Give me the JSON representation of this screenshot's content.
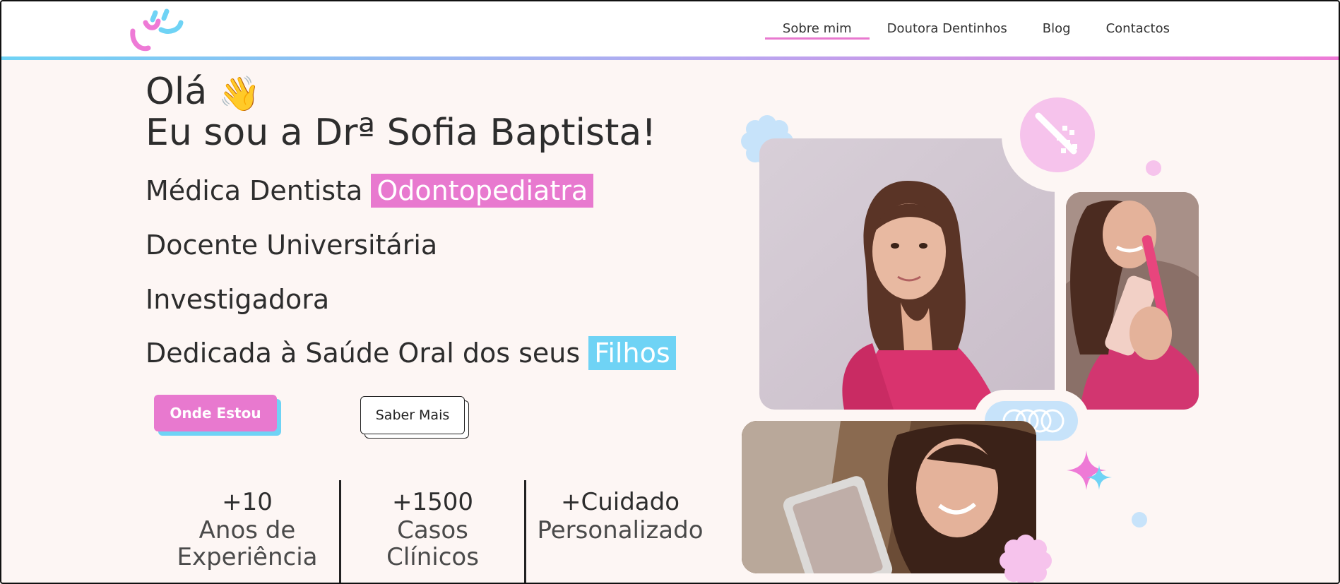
{
  "nav": {
    "items": [
      {
        "label": "Sobre mim",
        "active": true
      },
      {
        "label": "Doutora Dentinhos",
        "active": false
      },
      {
        "label": "Blog",
        "active": false
      },
      {
        "label": "Contactos",
        "active": false
      }
    ]
  },
  "hero": {
    "greeting": "Olá",
    "wave_emoji": "👋",
    "name": "Eu sou a Drª Sofia Baptista!",
    "roles": {
      "role1_prefix": "Médica Dentista",
      "role1_highlight": "Odontopediatra",
      "role2": "Docente Universitária",
      "role3": "Investigadora",
      "role4_prefix": "Dedicada à Saúde Oral dos seus",
      "role4_highlight": "Filhos"
    },
    "buttons": {
      "primary": "Onde Estou",
      "secondary": "Saber Mais"
    }
  },
  "stats": [
    {
      "number": "+10",
      "label_line1": "Anos de",
      "label_line2": "Experiência"
    },
    {
      "number": "+1500",
      "label_line1": "Casos",
      "label_line2": "Clínicos"
    },
    {
      "number": "+Cuidado",
      "label_line1": "Personalizado",
      "label_line2": ""
    }
  ],
  "colors": {
    "accent_pink": "#e879cf",
    "accent_blue": "#6fd3f5",
    "background": "#fdf6f4"
  },
  "icons": {
    "logo": "smiley-logo-icon",
    "toothbrush_badge": "toothbrush-icon",
    "braces_badge": "braces-icon"
  }
}
